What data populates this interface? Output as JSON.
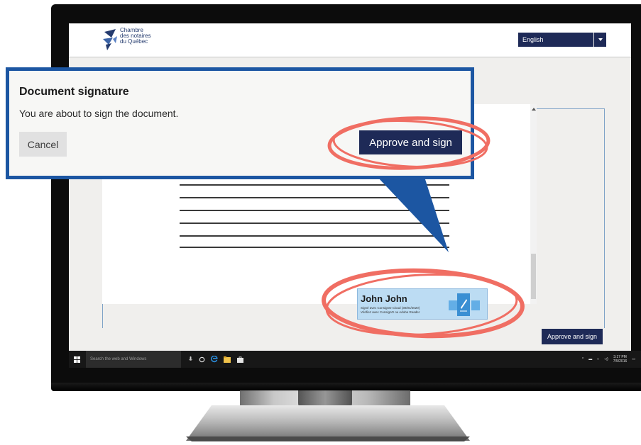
{
  "header": {
    "logo_lines": [
      "Chambre",
      "des notaires",
      "du Québec"
    ],
    "language": "English"
  },
  "document": {
    "signature": {
      "name": "John John",
      "line1": "Signé avec ConsignO Cloud (30/04/2020)",
      "line2": "Vérifiez avec ConsignO ou Adobe Reader"
    },
    "approve_label": "Approve and sign"
  },
  "taskbar": {
    "search_placeholder": "Search the web and Windows",
    "clock_time": "3:17 PM",
    "clock_date": "7/5/2016"
  },
  "dialog": {
    "title": "Document signature",
    "message": "You are about to sign the document.",
    "cancel_label": "Cancel",
    "approve_label": "Approve and sign"
  },
  "colors": {
    "navy_button": "#1e2a57",
    "callout_border": "#1c56a2",
    "highlight_ring": "#f06e63",
    "signature_fill": "#bcdcf3"
  },
  "icons": [
    "windows-logo-icon",
    "microphone-icon",
    "task-view-icon",
    "edge-browser-icon",
    "file-explorer-icon",
    "store-icon",
    "notification-icon"
  ]
}
